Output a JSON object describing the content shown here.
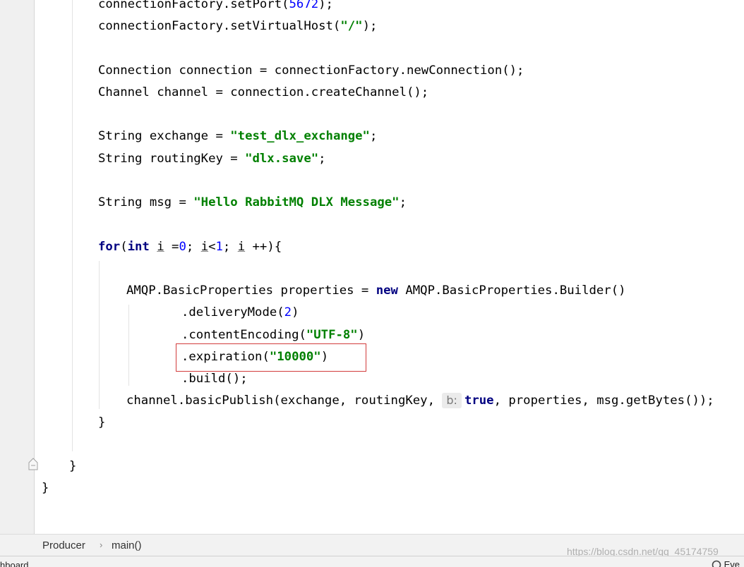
{
  "editor": {
    "lines": [
      {
        "id": "l01",
        "tokens": [
          {
            "t": "connectionFactory.setPort("
          },
          {
            "t": "5672",
            "c": "num"
          },
          {
            "t": ");"
          }
        ]
      },
      {
        "id": "l02",
        "tokens": [
          {
            "t": "connectionFactory.setVirtualHost("
          },
          {
            "t": "\"/\"",
            "c": "str"
          },
          {
            "t": ");"
          }
        ]
      },
      {
        "id": "l03",
        "tokens": [
          {
            "t": "Connection connection = connectionFactory.newConnection();"
          }
        ]
      },
      {
        "id": "l04",
        "tokens": [
          {
            "t": "Channel channel = connection.createChannel();"
          }
        ]
      },
      {
        "id": "l05",
        "tokens": [
          {
            "t": "String exchange = "
          },
          {
            "t": "\"test_dlx_exchange\"",
            "c": "str"
          },
          {
            "t": ";"
          }
        ]
      },
      {
        "id": "l06",
        "tokens": [
          {
            "t": "String routingKey = "
          },
          {
            "t": "\"dlx.save\"",
            "c": "str"
          },
          {
            "t": ";"
          }
        ]
      },
      {
        "id": "l07",
        "tokens": [
          {
            "t": "String msg = "
          },
          {
            "t": "\"Hello RabbitMQ DLX Message\"",
            "c": "str"
          },
          {
            "t": ";"
          }
        ]
      },
      {
        "id": "l08",
        "tokens": [
          {
            "t": "for",
            "c": "kw"
          },
          {
            "t": "("
          },
          {
            "t": "int",
            "c": "kw"
          },
          {
            "t": " "
          },
          {
            "t": "i",
            "c": "ul"
          },
          {
            "t": " ="
          },
          {
            "t": "0",
            "c": "num"
          },
          {
            "t": "; "
          },
          {
            "t": "i",
            "c": "ul"
          },
          {
            "t": "<"
          },
          {
            "t": "1",
            "c": "num"
          },
          {
            "t": "; "
          },
          {
            "t": "i",
            "c": "ul"
          },
          {
            "t": " ++){"
          }
        ]
      },
      {
        "id": "l09",
        "tokens": [
          {
            "t": "AMQP.BasicProperties properties = "
          },
          {
            "t": "new",
            "c": "kw"
          },
          {
            "t": " AMQP.BasicProperties.Builder()"
          }
        ]
      },
      {
        "id": "l10",
        "tokens": [
          {
            "t": ".deliveryMode("
          },
          {
            "t": "2",
            "c": "num"
          },
          {
            "t": ")"
          }
        ]
      },
      {
        "id": "l11",
        "tokens": [
          {
            "t": ".contentEncoding("
          },
          {
            "t": "\"UTF-8\"",
            "c": "str"
          },
          {
            "t": ")"
          }
        ]
      },
      {
        "id": "l12",
        "tokens": [
          {
            "t": ".expiration("
          },
          {
            "t": "\"10000\"",
            "c": "str"
          },
          {
            "t": ")"
          }
        ]
      },
      {
        "id": "l13",
        "tokens": [
          {
            "t": ".build();"
          }
        ]
      },
      {
        "id": "l14",
        "tokens": [
          {
            "t": "channel.basicPublish(exchange, routingKey, "
          },
          {
            "t": "b:",
            "c": "hint"
          },
          {
            "t": "true",
            "c": "kw"
          },
          {
            "t": ", properties, msg.getBytes());"
          }
        ]
      },
      {
        "id": "l15",
        "tokens": [
          {
            "t": "}"
          }
        ]
      },
      {
        "id": "l16",
        "tokens": [
          {
            "t": "}"
          }
        ]
      },
      {
        "id": "l17",
        "tokens": [
          {
            "t": "}"
          }
        ]
      }
    ]
  },
  "breadcrumb": {
    "items": [
      "Producer",
      "main()"
    ],
    "separator": "›"
  },
  "watermark": "https://blog.csdn.net/qq_45174759",
  "bottom_bar": {
    "left_text": "hboard",
    "right_text": "Eve"
  },
  "colors": {
    "keyword": "#000080",
    "string": "#008000",
    "number": "#0000ff",
    "highlight_box": "#d23c3c"
  }
}
